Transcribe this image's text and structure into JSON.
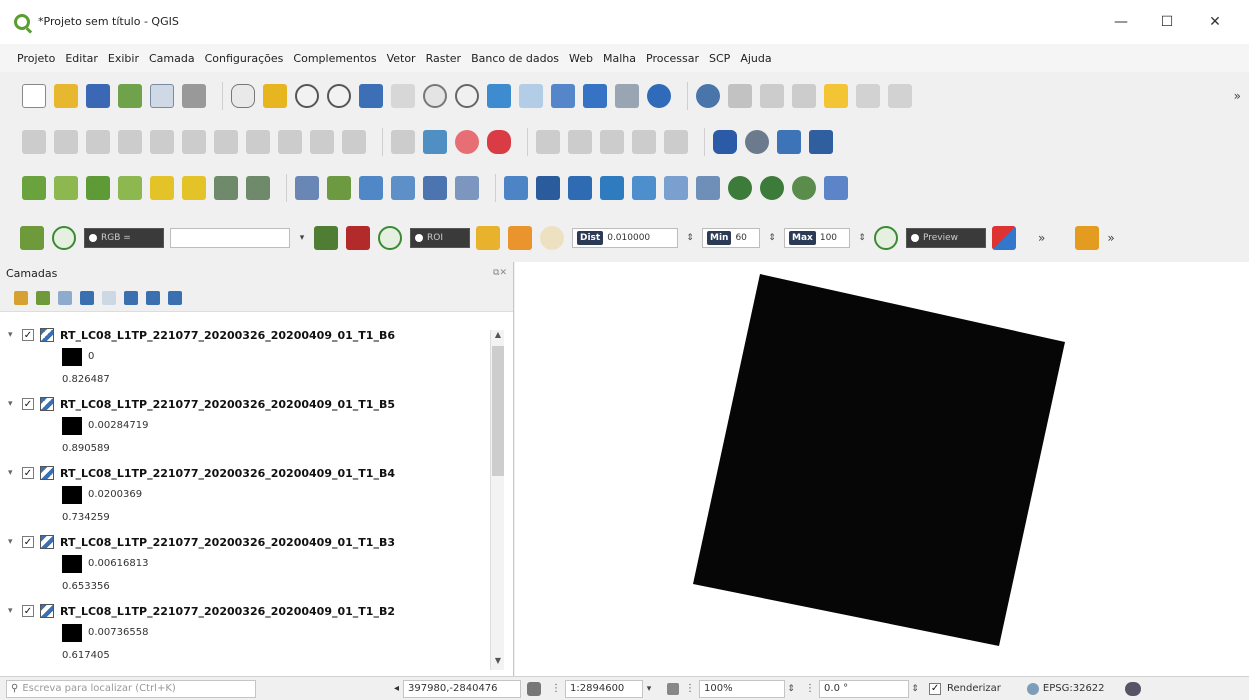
{
  "window": {
    "title": "*Projeto sem título - QGIS",
    "minimize": "—",
    "maximize": "☐",
    "close": "✕"
  },
  "menu": [
    "Projeto",
    "Editar",
    "Exibir",
    "Camada",
    "Configurações",
    "Complementos",
    "Vetor",
    "Raster",
    "Banco de dados",
    "Web",
    "Malha",
    "Processar",
    "SCP",
    "Ajuda"
  ],
  "scp": {
    "rgb_label": "RGB =",
    "roi_label": "ROI",
    "dist_tag": "Dist",
    "dist_value": "0.010000",
    "min_tag": "Min",
    "min_value": "60",
    "max_tag": "Max",
    "max_value": "100",
    "preview_label": "Preview"
  },
  "panel": {
    "title": "Camadas",
    "layers": [
      {
        "name": "RT_LC08_L1TP_221077_20200326_20200409_01_T1_B6",
        "min": "0",
        "max": "0.826487"
      },
      {
        "name": "RT_LC08_L1TP_221077_20200326_20200409_01_T1_B5",
        "min": "0.00284719",
        "max": "0.890589"
      },
      {
        "name": "RT_LC08_L1TP_221077_20200326_20200409_01_T1_B4",
        "min": "0.0200369",
        "max": "0.734259"
      },
      {
        "name": "RT_LC08_L1TP_221077_20200326_20200409_01_T1_B3",
        "min": "0.00616813",
        "max": "0.653356"
      },
      {
        "name": "RT_LC08_L1TP_221077_20200326_20200409_01_T1_B2",
        "min": "0.00736558",
        "max": "0.617405"
      }
    ]
  },
  "status": {
    "locator_placeholder": "Escreva para localizar (Ctrl+K)",
    "coordinate": "397980,-2840476",
    "scale": "1:2894600",
    "magnifier": "100%",
    "rotation": "0.0 °",
    "render_label": "Renderizar",
    "crs": "EPSG:32622"
  }
}
